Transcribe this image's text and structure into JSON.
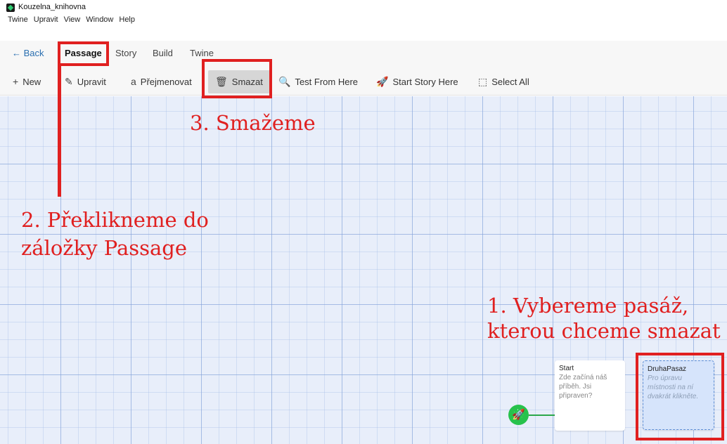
{
  "window": {
    "title": "Kouzelna_knihovna"
  },
  "menu": [
    "Twine",
    "Upravit",
    "View",
    "Window",
    "Help"
  ],
  "tabs": {
    "back": "← Back",
    "items": [
      "Passage",
      "Story",
      "Build",
      "Twine"
    ],
    "active": "Passage"
  },
  "toolbar": {
    "new": {
      "icon": "+",
      "label": "New"
    },
    "edit": {
      "icon": "✎",
      "label": "Upravit"
    },
    "rename": {
      "icon": "a",
      "label": "Přejmenovat"
    },
    "delete": {
      "icon": "🗑",
      "label": "Smazat"
    },
    "test": {
      "icon": "🔍",
      "label": "Test From Here"
    },
    "start": {
      "icon": "🚀",
      "label": "Start Story Here"
    },
    "select_all": {
      "icon": "⬚",
      "label": "Select All"
    }
  },
  "passages": [
    {
      "title": "Start",
      "excerpt": "Zde začíná náš příběh. Jsi připraven?"
    },
    {
      "title": "DruhaPasaz",
      "excerpt": "Pro úpravu místnosti na ní dvakrát klikněte."
    }
  ],
  "start_badge": "🚀",
  "annotations": {
    "step1_line1": "1. Vybereme pasáž,",
    "step1_line2": "kterou chceme smazat",
    "step2_line1": "2. Překlikneme do",
    "step2_line2": "záložky Passage",
    "step3": "3. Smažeme"
  },
  "colors": {
    "annotation_red": "#e02020",
    "start_green": "#27c24c",
    "link_blue": "#2a6fb0"
  }
}
